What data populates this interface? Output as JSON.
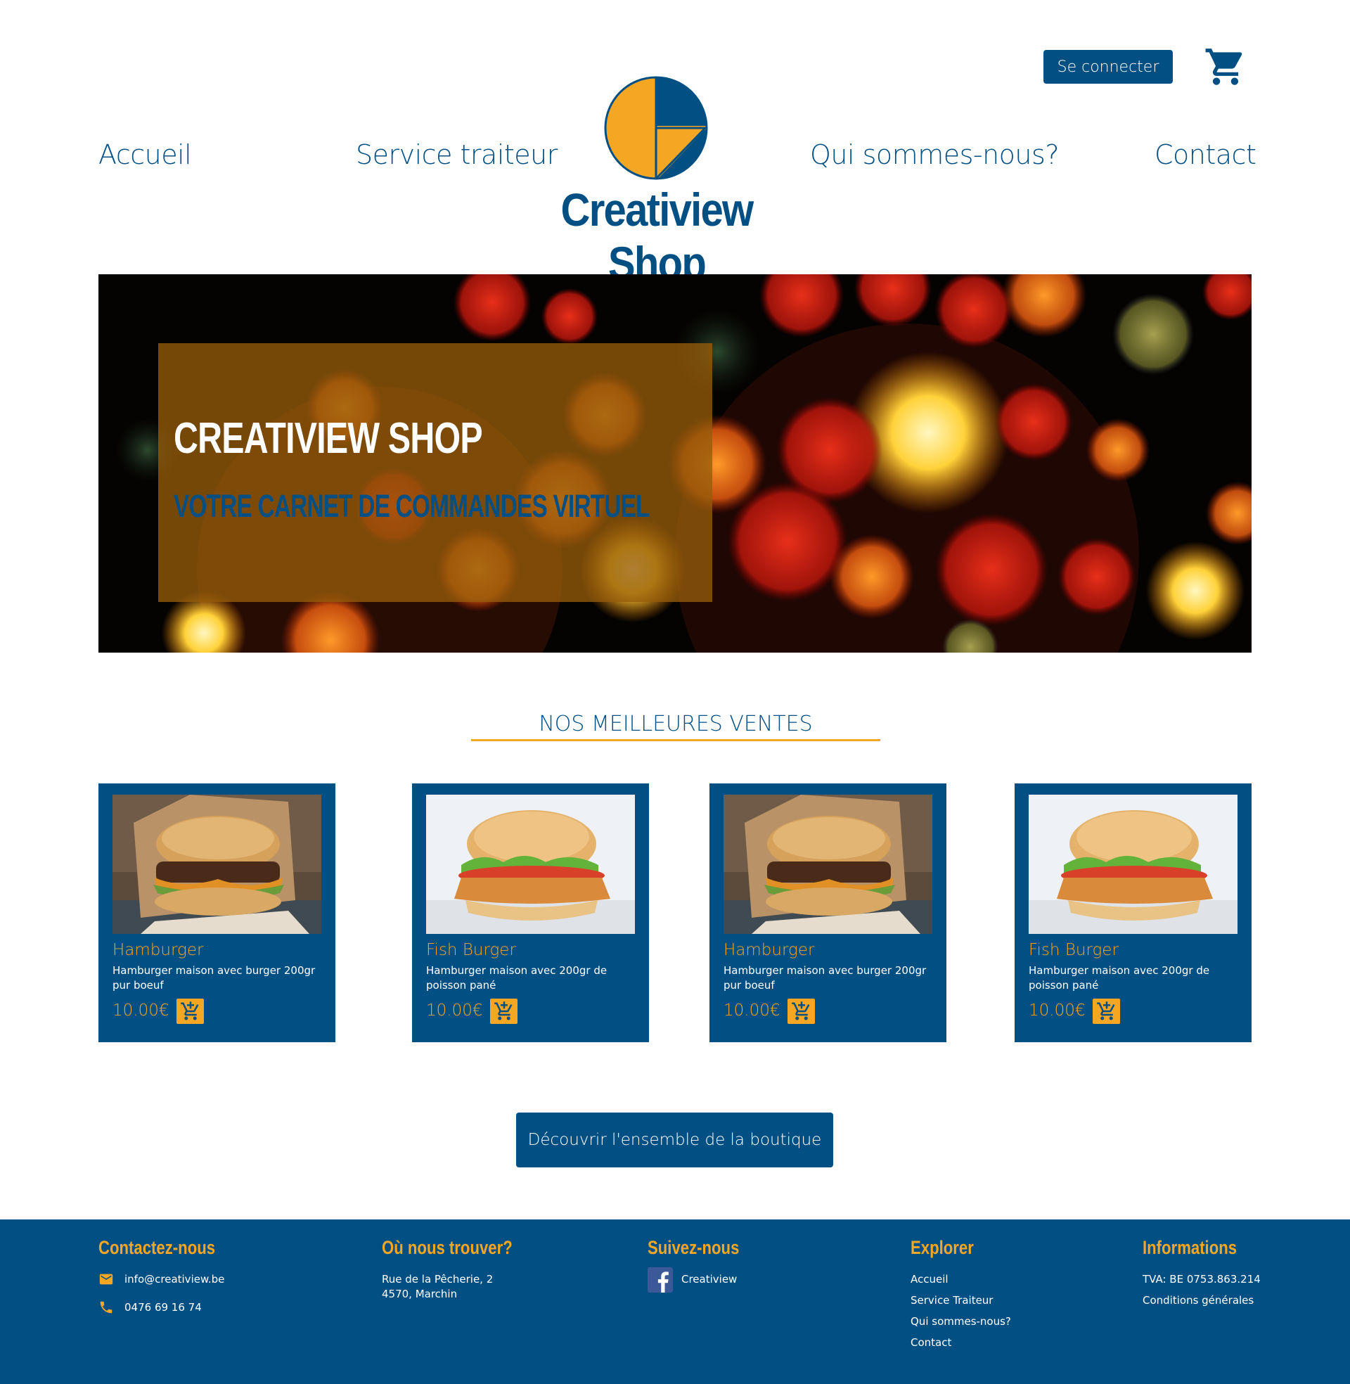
{
  "header": {
    "login_label": "Se connecter",
    "cart_icon": "shopping-cart-icon",
    "nav": {
      "home": "Accueil",
      "catering": "Service traiteur",
      "about": "Qui sommes-nous?",
      "contact": "Contact"
    },
    "brand": "Creatiview Shop",
    "logo_icon": "creatiview-logo"
  },
  "hero": {
    "title": "CREATIVIEW SHOP",
    "subtitle": "VOTRE CARNET DE COMMANDES VIRTUEL"
  },
  "bestsellers": {
    "title": "NOS MEILLEURES VENTES",
    "products": [
      {
        "name": "Hamburger",
        "desc": "Hamburger maison avec burger 200gr pur boeuf",
        "price": "10.00€",
        "image": "beef-burger"
      },
      {
        "name": "Fish Burger",
        "desc": "Hamburger maison avec 200gr de poisson pané",
        "price": "10.00€",
        "image": "fish-burger"
      },
      {
        "name": "Hamburger",
        "desc": "Hamburger maison avec burger 200gr pur boeuf",
        "price": "10.00€",
        "image": "beef-burger"
      },
      {
        "name": "Fish Burger",
        "desc": "Hamburger maison avec 200gr de poisson pané",
        "price": "10.00€",
        "image": "fish-burger"
      }
    ],
    "cart_icon": "add-to-cart-icon"
  },
  "discover_label": "Découvrir l'ensemble de la boutique",
  "footer": {
    "contact": {
      "title": "Contactez-nous",
      "email": "info@creatiview.be",
      "phone": "0476 69 16 74"
    },
    "location": {
      "title": "Où nous trouver?",
      "line1": "Rue de la Pêcherie, 2",
      "line2": "4570, Marchin"
    },
    "follow": {
      "title": "Suivez-nous",
      "facebook": "Creatiview"
    },
    "explore": {
      "title": "Explorer",
      "links": [
        "Accueil",
        "Service Traiteur",
        "Qui sommes-nous?",
        "Contact"
      ]
    },
    "info": {
      "title": "Informations",
      "vat": "TVA: BE 0753.863.214",
      "terms": "Conditions générales"
    }
  },
  "colors": {
    "primary": "#024f84",
    "accent": "#f5a623",
    "white": "#ffffff"
  }
}
